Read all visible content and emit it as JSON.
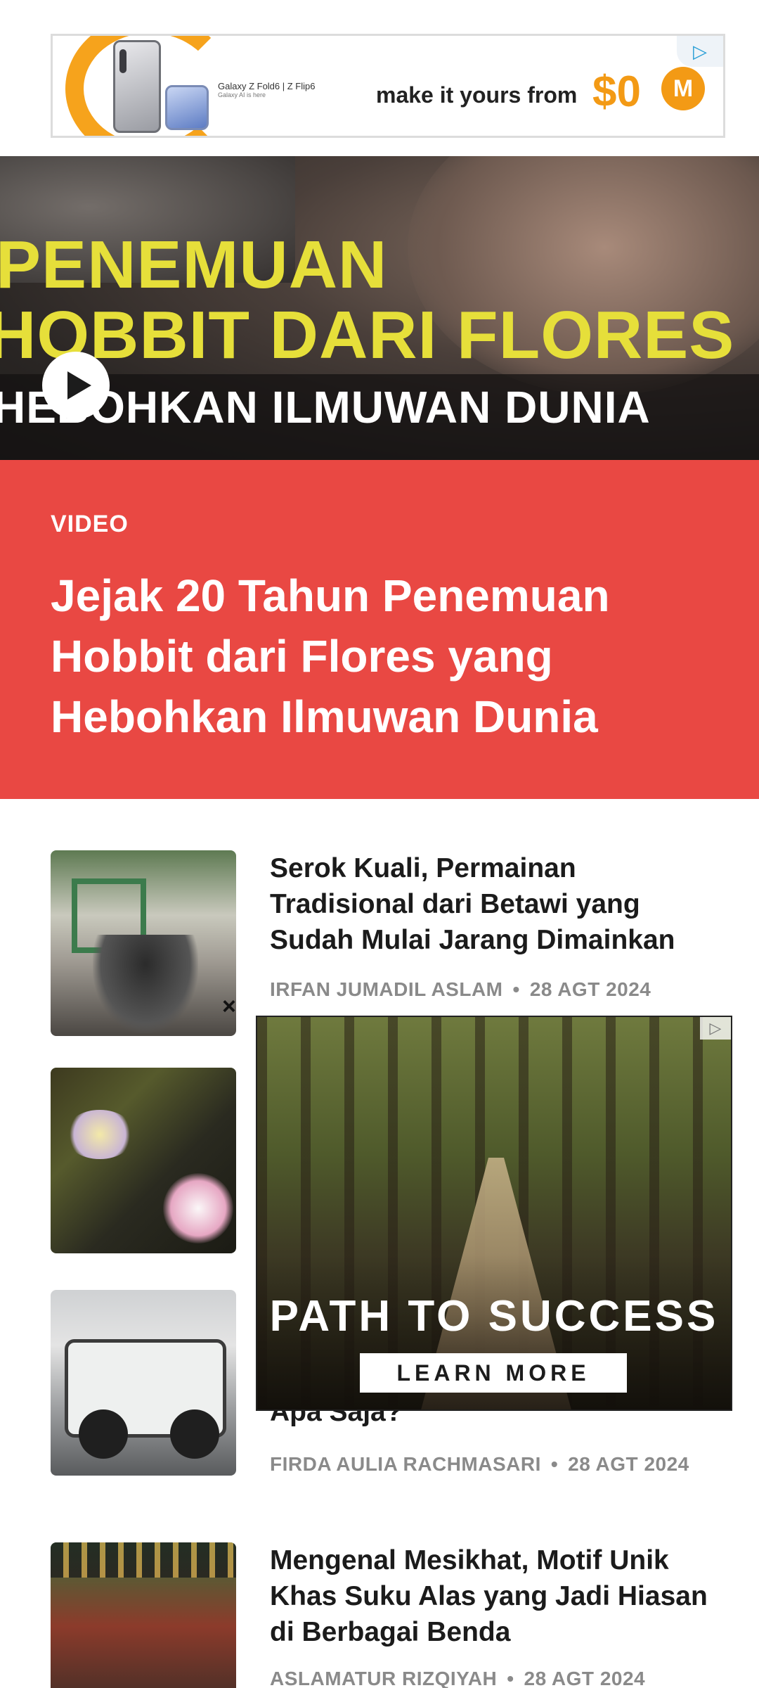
{
  "top_ad": {
    "model_text": "Galaxy Z Fold6 | Z Flip6",
    "model_subtext": "Galaxy AI is here",
    "tagline": "make it yours from",
    "price": "$0",
    "brand_letter": "M",
    "adchoice_icon": "adchoices-icon"
  },
  "hero": {
    "overlay_line_1": "PENEMUAN",
    "overlay_line_2": "HOBBIT DARI FLORES",
    "overlay_line_3": "HEBOHKAN ILMUWAN DUNIA",
    "play_icon": "play-icon"
  },
  "featured": {
    "kicker": "VIDEO",
    "title": "Jejak 20 Tahun Penemuan Hobbit dari Flores yang Hebohkan Ilmuwan Dunia"
  },
  "articles": [
    {
      "title": "Serok Kuali, Permainan Tradisional dari Betawi yang Sudah Mulai Jarang Dimainkan",
      "author": "IRFAN JUMADIL ASLAM",
      "date": "28 AGT 2024"
    },
    {
      "title": "",
      "author": "",
      "date": ""
    },
    {
      "title": "Apa Saja?",
      "author": "FIRDA AULIA RACHMASARI",
      "date": "28 AGT 2024"
    },
    {
      "title": "Mengenal Mesikhat, Motif Unik Khas Suku Alas yang Jadi Hiasan di Berbagai Benda",
      "author": "ASLAMATUR RIZQIYAH",
      "date": "28 AGT 2024"
    }
  ],
  "overlay_ad": {
    "close_label": "×",
    "headline": "PATH TO SUCCESS",
    "cta": "LEARN MORE"
  },
  "colors": {
    "featured_bg": "#e94843",
    "ad_accent": "#f39a15",
    "meta_gray": "#8a8a8a"
  }
}
